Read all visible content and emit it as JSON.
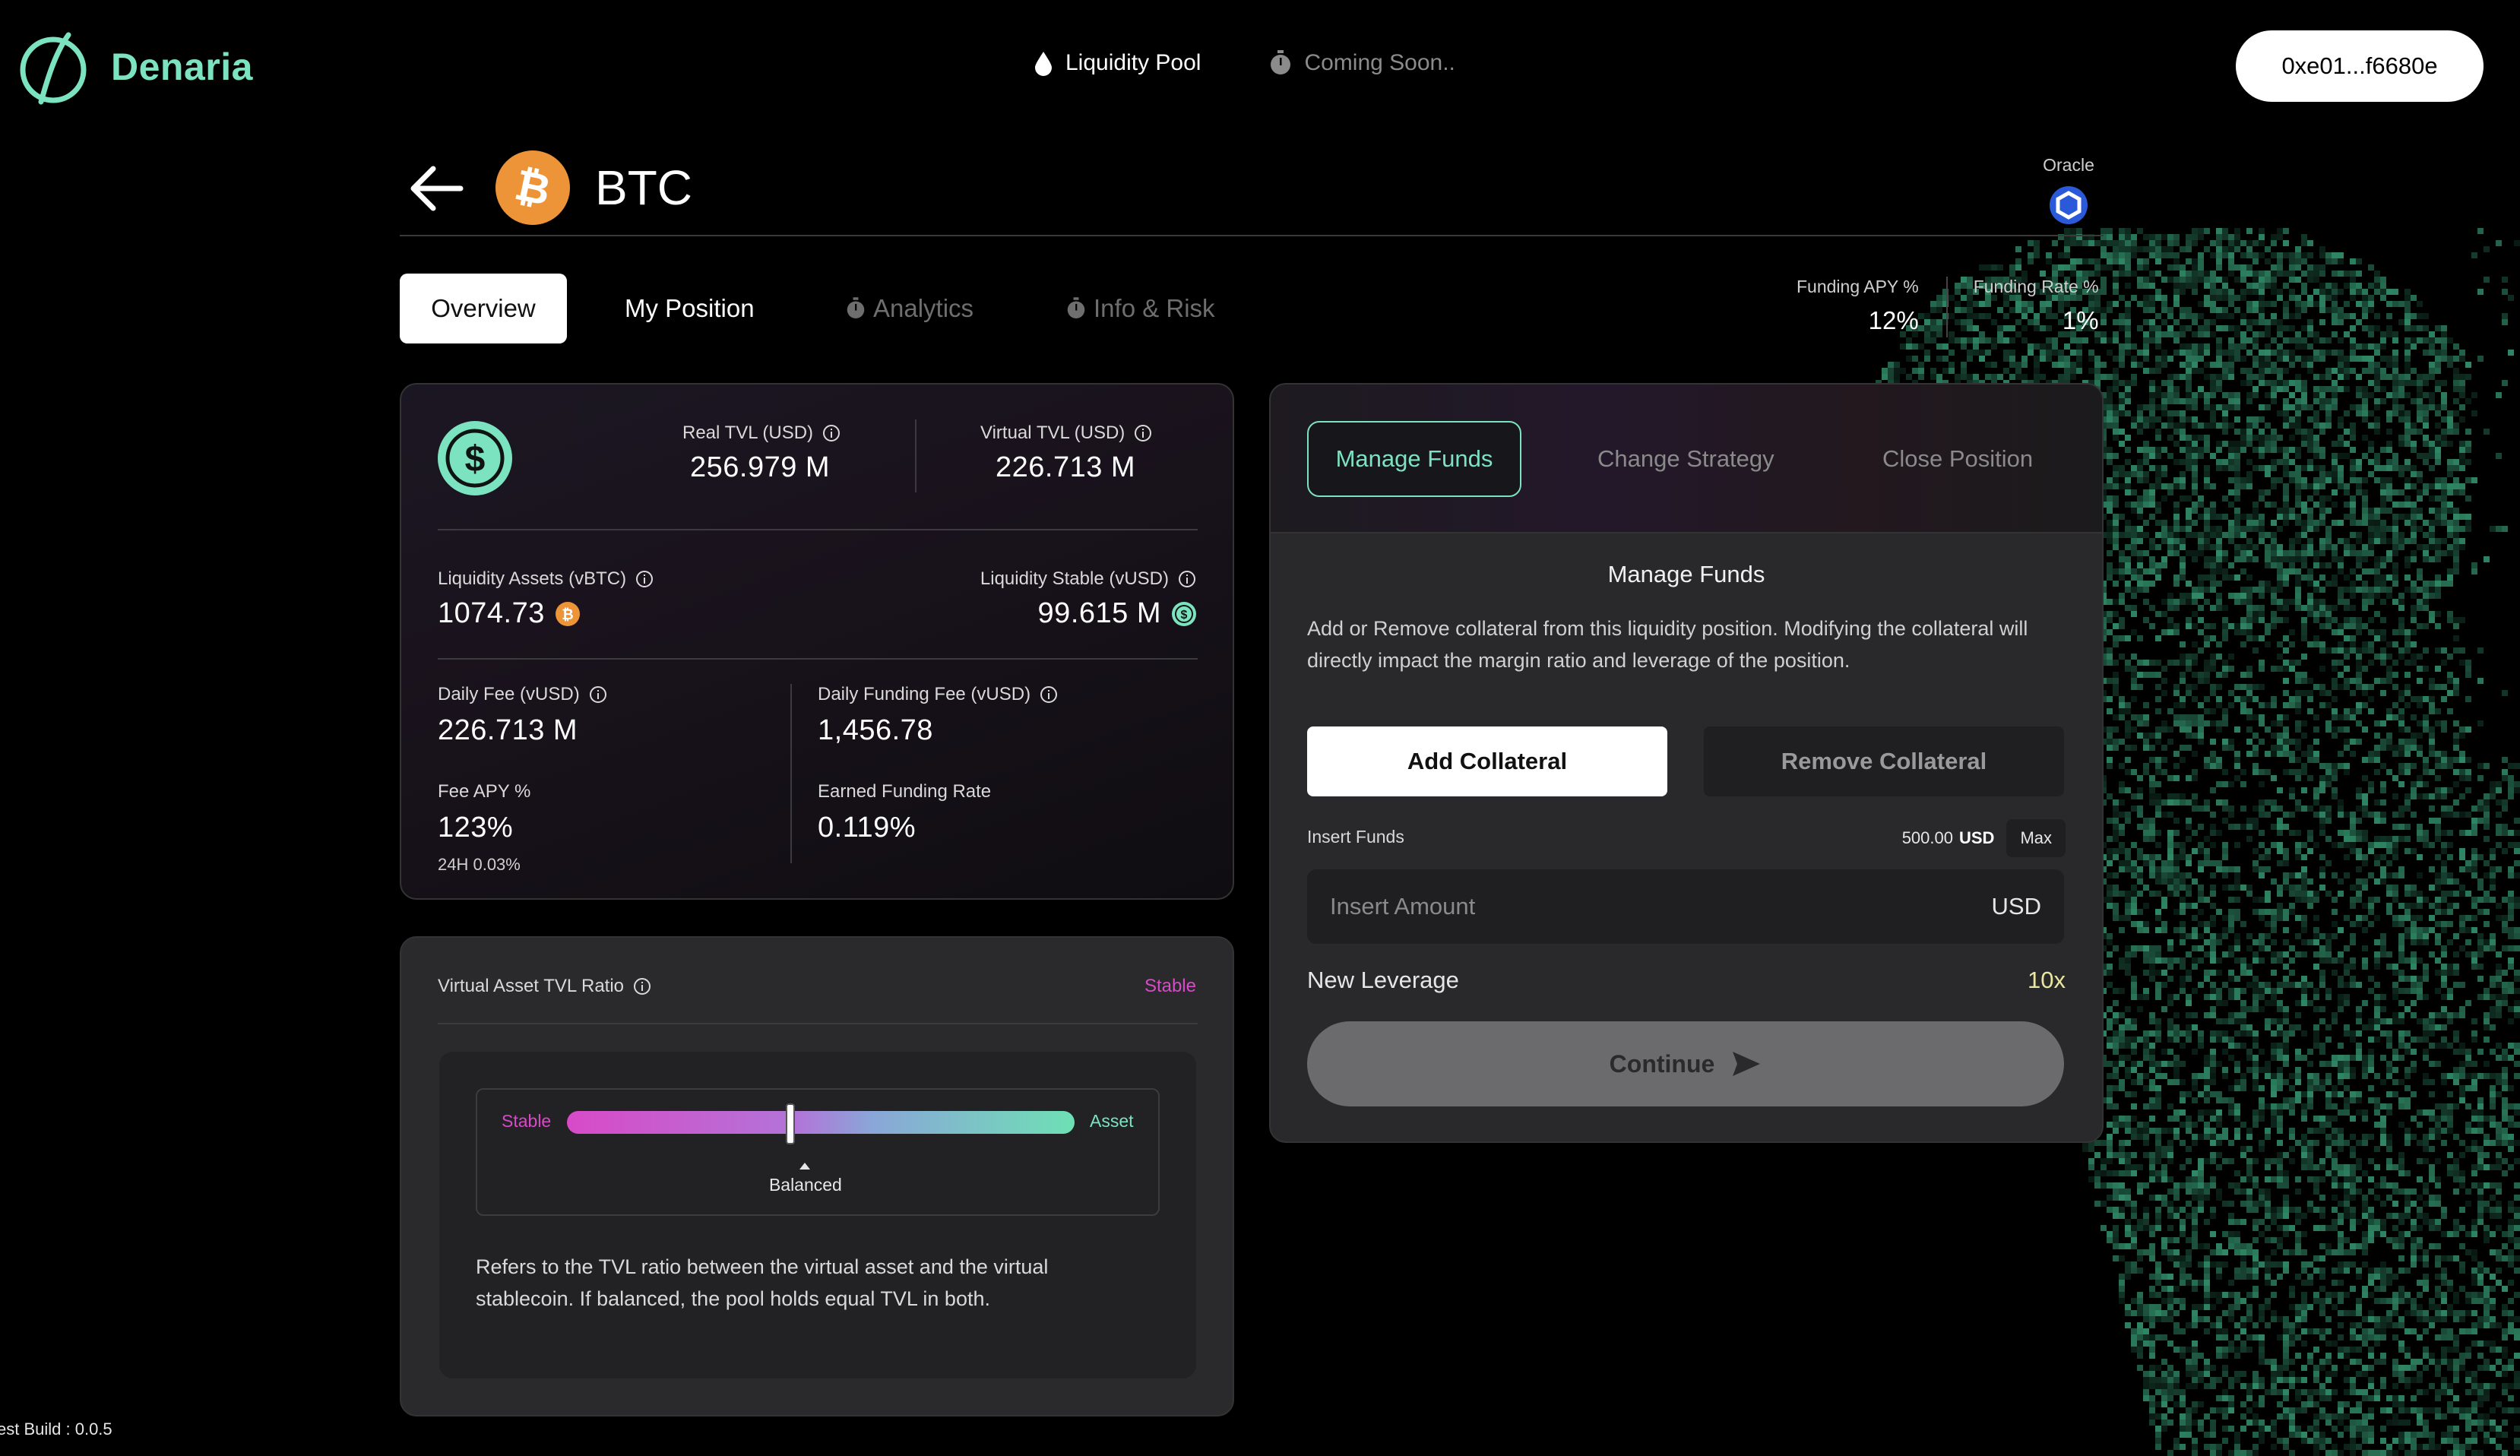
{
  "brand": {
    "name": "Denaria",
    "accent": "#7ce3c0"
  },
  "nav": {
    "items": [
      {
        "label": "Liquidity Pool",
        "icon": "droplet-icon"
      },
      {
        "label": "Coming Soon..",
        "icon": "stopwatch-icon"
      }
    ]
  },
  "wallet": {
    "address": "0xe01...f6680e"
  },
  "pool": {
    "symbol": "BTC",
    "oracle_label": "Oracle"
  },
  "tabs": [
    "Overview",
    "My Position",
    "Analytics",
    "Info & Risk"
  ],
  "funding": {
    "apy_label": "Funding APY %",
    "apy_value": "12%",
    "rate_label": "Funding Rate %",
    "rate_value": "1%"
  },
  "overview": {
    "real_tvl_label": "Real TVL (USD)",
    "real_tvl_value": "256.979 M",
    "virtual_tvl_label": "Virtual TVL (USD)",
    "virtual_tvl_value": "226.713 M",
    "liq_assets_label": "Liquidity Assets (vBTC)",
    "liq_assets_value": "1074.73",
    "liq_stable_label": "Liquidity Stable (vUSD)",
    "liq_stable_value": "99.615 M",
    "daily_fee_label": "Daily Fee (vUSD)",
    "daily_fee_value": "226.713 M",
    "daily_funding_fee_label": "Daily Funding Fee (vUSD)",
    "daily_funding_fee_value": "1,456.78",
    "fee_apy_label": "Fee APY %",
    "fee_apy_value": "123%",
    "fee_apy_24h": "24H 0.03%",
    "earned_funding_label": "Earned Funding Rate",
    "earned_funding_value": "0.119%"
  },
  "ratio": {
    "title": "Virtual Asset TVL Ratio",
    "state": "Stable",
    "left_label": "Stable",
    "right_label": "Asset",
    "position": 0.44,
    "marker_label": "Balanced",
    "description": "Refers to the TVL ratio between the virtual asset and the virtual stablecoin. If balanced, the pool holds equal TVL in both."
  },
  "funds": {
    "tabs": [
      "Manage Funds",
      "Change Strategy",
      "Close Position"
    ],
    "title": "Manage Funds",
    "description": "Add or Remove collateral from this liquidity position. Modifying the collateral will directly impact the margin ratio and leverage of the position.",
    "add_label": "Add Collateral",
    "remove_label": "Remove Collateral",
    "insert_label": "Insert Funds",
    "balance_amount": "500.00",
    "balance_unit": "USD",
    "max_label": "Max",
    "input_placeholder": "Insert Amount",
    "input_unit": "USD",
    "leverage_label": "New Leverage",
    "leverage_value": "10x",
    "continue_label": "Continue"
  },
  "build": {
    "label": "est Build : 0.0.5"
  },
  "colors": {
    "pink": "#d84ac8",
    "green": "#7ce3c0",
    "leverage_yellow": "#e9e6a0",
    "btc_orange": "#ee9438"
  }
}
